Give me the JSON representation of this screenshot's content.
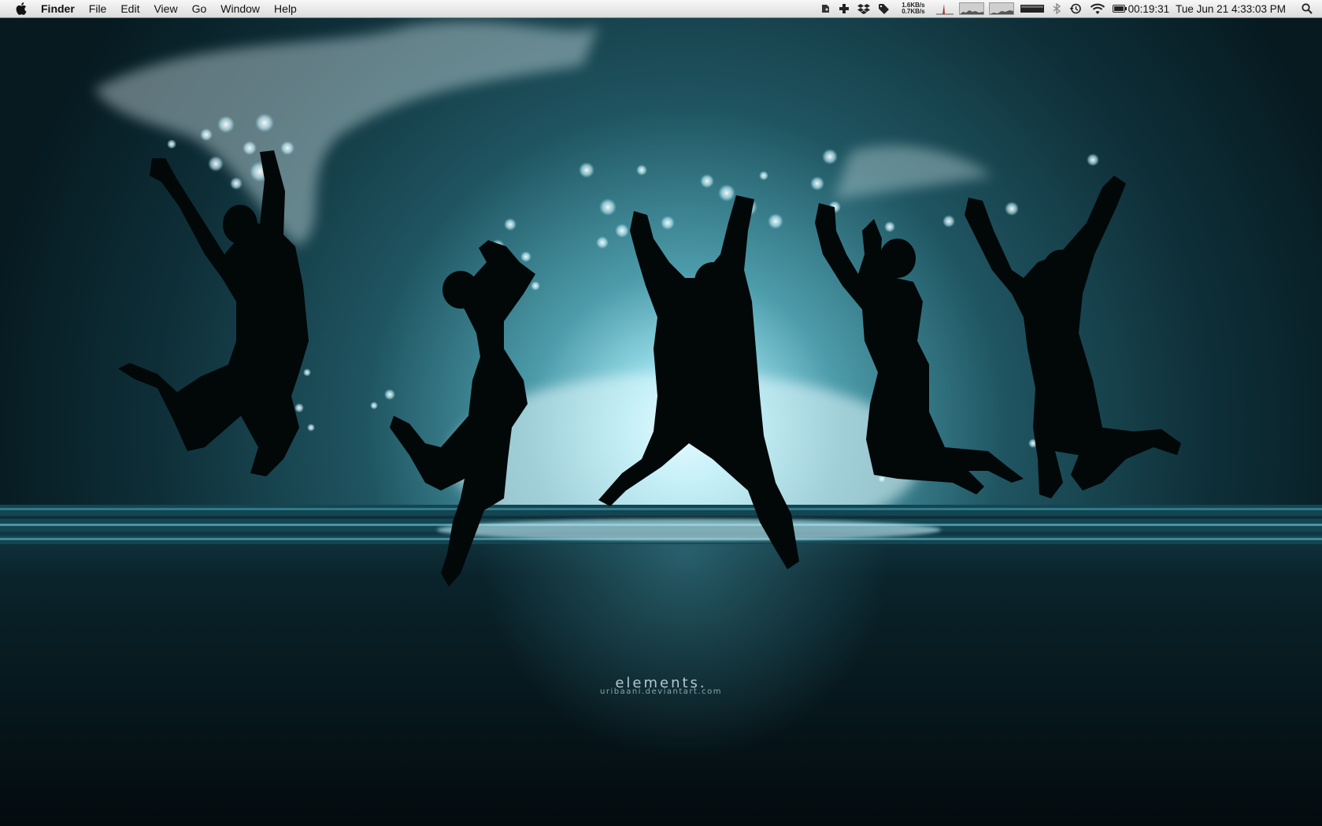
{
  "menubar": {
    "app_name": "Finder",
    "menus": [
      "File",
      "Edit",
      "View",
      "Go",
      "Window",
      "Help"
    ],
    "status": {
      "net_up": "1.6KB/s",
      "net_down": "0.7KB/s",
      "battery_time": "00:19:31",
      "clock": "Tue  Jun 21  4:33:03 PM"
    },
    "icons": [
      "evernote-icon",
      "crashplan-icon",
      "dropbox-icon",
      "tag-icon",
      "network-graph-icon",
      "cpu-graph-icon",
      "memory-graph-icon",
      "disk-meter-icon",
      "bluetooth-icon",
      "time-machine-icon",
      "wifi-icon",
      "battery-icon",
      "spotlight-icon"
    ]
  },
  "wallpaper": {
    "watermark_title": "elements.",
    "watermark_url": "uribaani.deviantart.com",
    "colors": {
      "sky_glow": "#bfeef5",
      "sky_mid": "#3f7f8c",
      "sky_dark": "#0b2730",
      "sand": "#061319",
      "silhouette": "#020708"
    }
  }
}
